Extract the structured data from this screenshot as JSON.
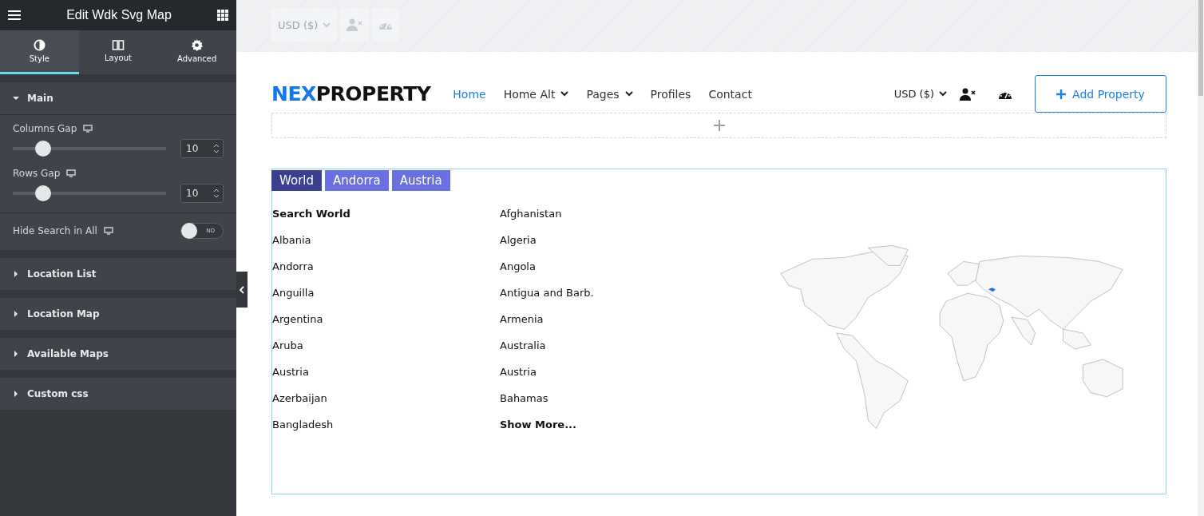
{
  "panel": {
    "title": "Edit Wdk Svg Map",
    "tabs": [
      {
        "label": "Style",
        "selected": true
      },
      {
        "label": "Layout",
        "selected": false
      },
      {
        "label": "Advanced",
        "selected": false
      }
    ],
    "sections": [
      {
        "title": "Main",
        "expanded": true,
        "controls": [
          {
            "kind": "slider",
            "label": "Columns Gap",
            "level": 0.16,
            "value": "10"
          },
          {
            "kind": "slider",
            "label": "Rows Gap",
            "level": 0.16,
            "value": "10"
          },
          {
            "kind": "switch",
            "label": "Hide Search in All",
            "on": false,
            "state_label": "NO"
          }
        ]
      },
      {
        "title": "Location List",
        "expanded": false
      },
      {
        "title": "Location Map",
        "expanded": false
      },
      {
        "title": "Available Maps",
        "expanded": false
      },
      {
        "title": "Custom css",
        "expanded": false
      }
    ]
  },
  "ghost_header": {
    "currency": "USD ($)"
  },
  "header": {
    "logo": {
      "accent": "NEX",
      "rest": "PROPERTY"
    },
    "nav": [
      {
        "label": "Home",
        "selected": true,
        "dropdown": false
      },
      {
        "label": "Home Alt",
        "selected": false,
        "dropdown": true
      },
      {
        "label": "Pages",
        "selected": false,
        "dropdown": true
      },
      {
        "label": "Profiles",
        "selected": false,
        "dropdown": false
      },
      {
        "label": "Contact",
        "selected": false,
        "dropdown": false
      }
    ],
    "currency": "USD ($)",
    "add_button": "Add Property"
  },
  "map_widget": {
    "tabs": [
      {
        "label": "World",
        "selected": true
      },
      {
        "label": "Andorra",
        "selected": false
      },
      {
        "label": "Austria",
        "selected": false
      }
    ],
    "columns": [
      [
        {
          "kind": "search",
          "label": "Search World"
        },
        {
          "kind": "link",
          "label": "Albania"
        },
        {
          "kind": "link",
          "label": "Andorra"
        },
        {
          "kind": "link",
          "label": "Anguilla"
        },
        {
          "kind": "link",
          "label": "Argentina"
        },
        {
          "kind": "link",
          "label": "Aruba"
        },
        {
          "kind": "link",
          "label": "Austria"
        },
        {
          "kind": "link",
          "label": "Azerbaijan"
        },
        {
          "kind": "link",
          "label": "Bangladesh"
        }
      ],
      [
        {
          "kind": "link",
          "label": "Afghanistan"
        },
        {
          "kind": "link",
          "label": "Algeria"
        },
        {
          "kind": "link",
          "label": "Angola"
        },
        {
          "kind": "link",
          "label": "Antigua and Barb."
        },
        {
          "kind": "link",
          "label": "Armenia"
        },
        {
          "kind": "link",
          "label": "Australia"
        },
        {
          "kind": "link",
          "label": "Austria"
        },
        {
          "kind": "link",
          "label": "Bahamas"
        },
        {
          "kind": "more",
          "label": "Show More..."
        }
      ]
    ]
  }
}
